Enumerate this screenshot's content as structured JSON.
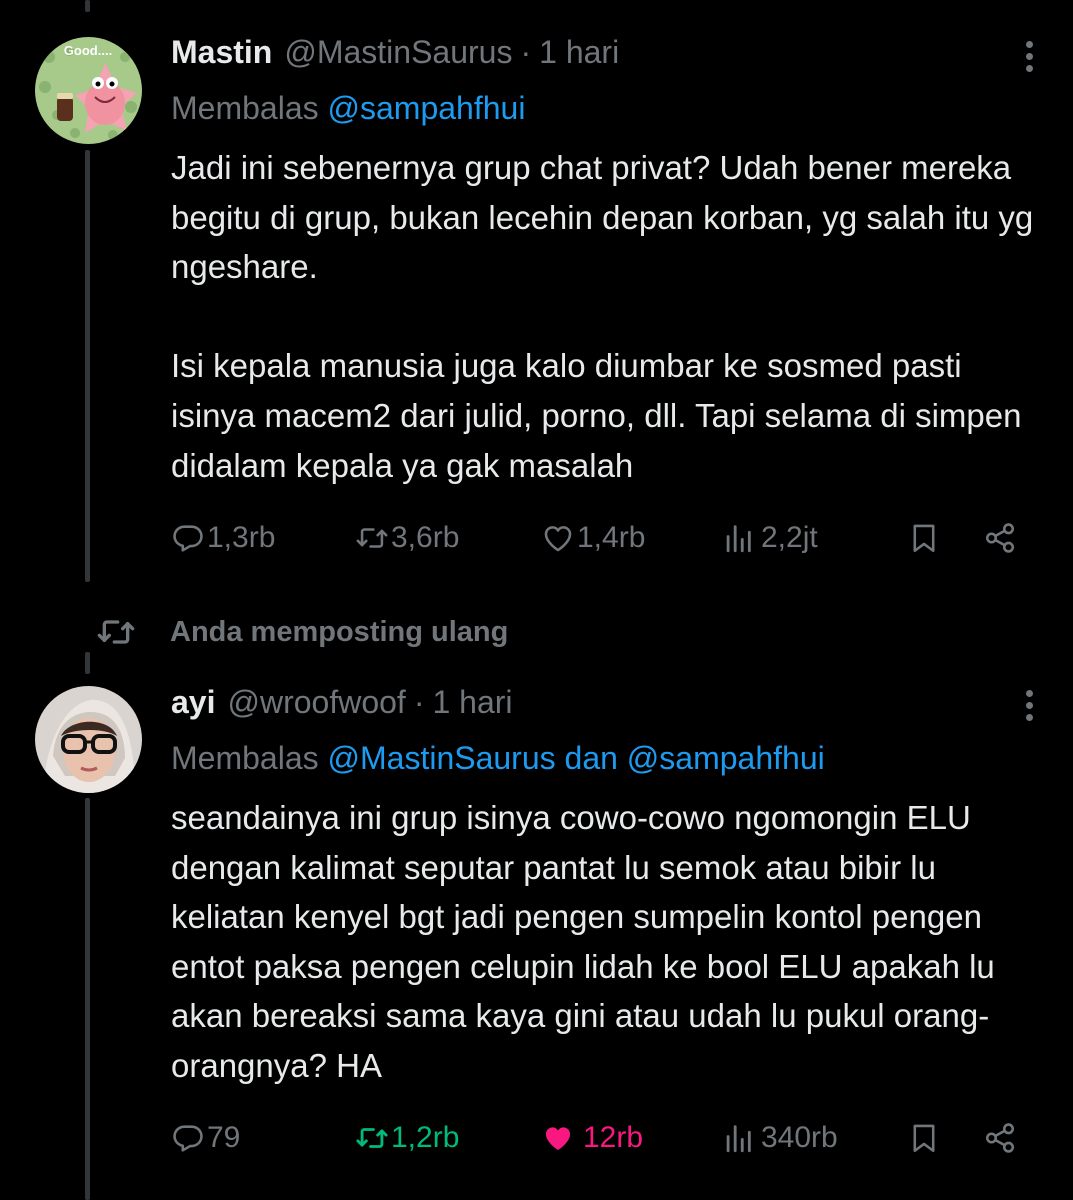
{
  "tweets": [
    {
      "name": "Mastin",
      "handle": "@MastinSaurus",
      "dot": "·",
      "time": "1 hari",
      "avatar_text": "Good....",
      "replying_label": "Membalas",
      "replying_to_1": "@sampahfhui",
      "paragraphs": [
        "Jadi ini sebenernya grup chat privat? Udah bener mereka begitu di grup, bukan lecehin depan korban, yg salah itu yg ngeshare.",
        "Isi kepala manusia juga kalo diumbar ke sosmed pasti isinya macem2 dari julid, porno, dll. Tapi selama di simpen didalam kepala ya gak masalah"
      ],
      "stats": {
        "replies": "1,3rb",
        "reposts": "3,6rb",
        "likes": "1,4rb",
        "views": "2,2jt"
      }
    },
    {
      "name": "ayi",
      "handle": "@wroofwoof",
      "dot": "·",
      "time": "1 hari",
      "replying_label": "Membalas",
      "replying_to_1": "@MastinSaurus",
      "replying_joiner": "dan",
      "replying_to_2": "@sampahfhui",
      "paragraphs": [
        "seandainya ini grup isinya cowo-cowo ngomongin ELU dengan kalimat seputar pantat lu semok atau bibir lu keliatan kenyel bgt jadi pengen sumpelin kontol pengen entot paksa pengen celupin lidah ke bool ELU apakah lu akan bereaksi sama kaya gini atau udah lu pukul orang-orangnya? HA"
      ],
      "stats": {
        "replies": "79",
        "reposts": "1,2rb",
        "likes": "12rb",
        "views": "340rb"
      },
      "reposted_by_you": true,
      "liked_by_you": true
    }
  ],
  "repost_banner": "Anda memposting ulang",
  "colors": {
    "background": "#000000",
    "text": "#e7e9ea",
    "muted": "#71767b",
    "link": "#1d9bf0",
    "repost_active": "#00ba7c",
    "like_active": "#f91880"
  },
  "icons": [
    "reply-icon",
    "repost-icon",
    "like-icon",
    "views-icon",
    "bookmark-icon",
    "share-icon",
    "more-icon"
  ]
}
